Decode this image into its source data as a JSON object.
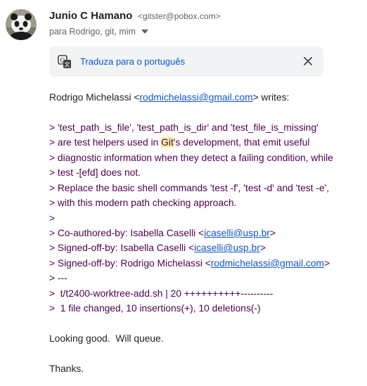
{
  "sender": {
    "name": "Junio C Hamano",
    "email": "<gitster@pobox.com>",
    "recipients": "para Rodrigo, git, mim"
  },
  "translate": {
    "label": "Traduza para o português"
  },
  "icons": {
    "avatar": "avatar-photo",
    "recipients_caret": "caret-down-icon",
    "translate": "translate-icon",
    "close": "close-icon"
  },
  "message": {
    "intro_name": "Rodrigo Michelassi <",
    "intro_email": "rodmichelassi@gmail.com",
    "intro_end": "> writes:",
    "q1": "> 'test_path_is_file', 'test_path_is_dir' and 'test_file_is_missing'",
    "q2_before": "> are test helpers used in ",
    "q2_highlight": "Git",
    "q2_after": "'s development, that emit useful",
    "q3": "> diagnostic information when they detect a failing condition, while",
    "q4": "> test -[efd] does not.",
    "q5": "> Replace the basic shell commands 'test -f', 'test -d' and 'test -e',",
    "q6": "> with this modern path checking approach.",
    "q7": ">",
    "q8_before": "> Co-authored-by: Isabella Caselli <",
    "q8_email": "icaselli@usp.br",
    "q8_end": ">",
    "q9_before": "> Signed-off-by: Isabella Caselli <",
    "q9_email": "icaselli@usp.br",
    "q9_end": ">",
    "q10_before": "> Signed-off-by: Rodrigo Michelassi <",
    "q10_email": "rodmichelassi@gmail.com",
    "q10_end": ">",
    "q11": "> ---",
    "q12": ">  t/t2400-worktree-add.sh | 20 ++++++++++----------",
    "q13": ">  1 file changed, 10 insertions(+), 10 deletions(-)",
    "reply1": "Looking good.  Will queue.",
    "reply2": "Thanks."
  }
}
